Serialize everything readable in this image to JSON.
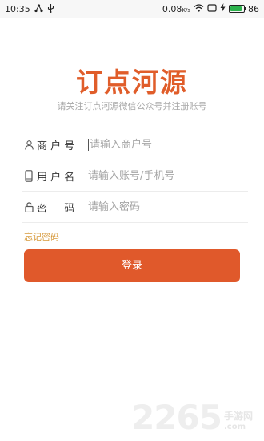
{
  "status_bar": {
    "time": "10:35",
    "network_speed": "0.08",
    "speed_unit": "K/s",
    "battery_level": "86",
    "battery_fraction": 0.86,
    "battery_color": "#2bb24c"
  },
  "app": {
    "logo_title": "订点河源",
    "subtitle": "请关注订点河源微信公众号并注册账号",
    "brand_color": "#e05d2a"
  },
  "form": {
    "merchant": {
      "label": "商 户 号",
      "placeholder": "请输入商户号",
      "icon": "person-icon"
    },
    "username": {
      "label": "用 户 名",
      "placeholder": "请输入账号/手机号",
      "icon": "phone-icon"
    },
    "password": {
      "label": "密 　 码",
      "placeholder": "请输入密码",
      "icon": "lock-icon"
    },
    "forgot_label": "忘记密码",
    "login_label": "登录"
  },
  "watermark": {
    "number": "2265",
    "suffix": ".com",
    "site": "手游网"
  }
}
